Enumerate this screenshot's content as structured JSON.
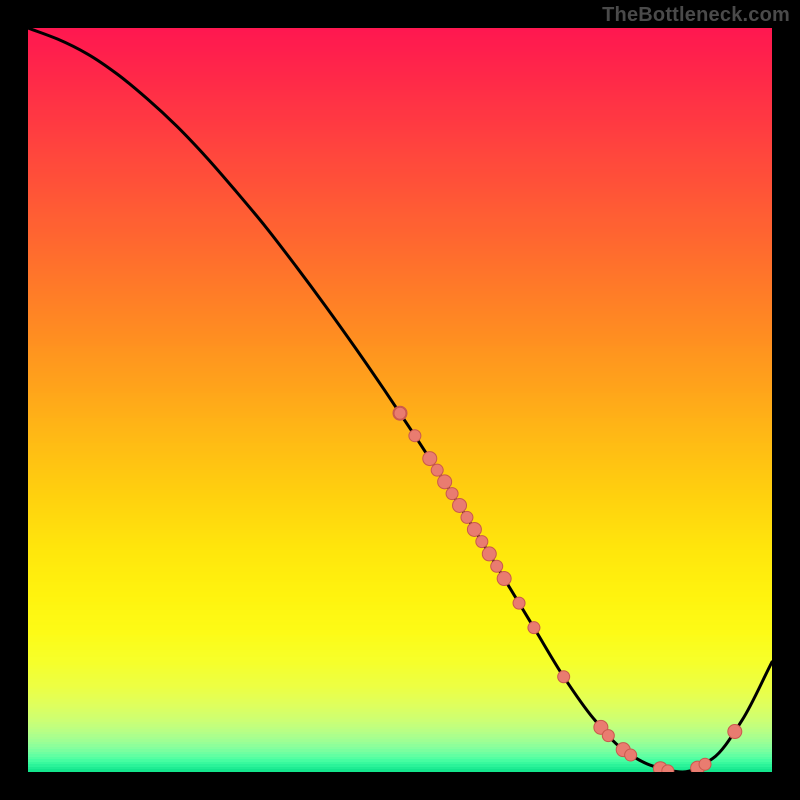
{
  "watermark": "TheBottleneck.com",
  "chart_data": {
    "type": "line",
    "title": "",
    "xlabel": "",
    "ylabel": "",
    "xlim": [
      0,
      100
    ],
    "ylim": [
      0,
      100
    ],
    "grid": false,
    "series": [
      {
        "name": "bottleneck-curve",
        "x": [
          0,
          4,
          8,
          12,
          16,
          20,
          24,
          28,
          32,
          36,
          40,
          44,
          48,
          52,
          56,
          60,
          64,
          68,
          72,
          76,
          80,
          84,
          88,
          92,
          96,
          100
        ],
        "y": [
          100,
          98.5,
          96.5,
          93.8,
          90.5,
          86.8,
          82.6,
          78.0,
          73.2,
          68.0,
          62.6,
          57.0,
          51.2,
          45.2,
          39.0,
          32.6,
          26.0,
          19.4,
          12.8,
          7.2,
          3.0,
          0.8,
          0.0,
          1.8,
          7.0,
          14.8
        ]
      }
    ],
    "scatter_overlay": {
      "name": "highlighted-points",
      "points": [
        {
          "x": 50,
          "y": 48.2,
          "r": 7
        },
        {
          "x": 50,
          "y": 46.2,
          "r": 6
        },
        {
          "x": 52,
          "y": 45.2,
          "r": 6
        },
        {
          "x": 54,
          "y": 42.1,
          "r": 7
        },
        {
          "x": 55,
          "y": 40.5,
          "r": 6
        },
        {
          "x": 56,
          "y": 39.0,
          "r": 7
        },
        {
          "x": 57,
          "y": 37.4,
          "r": 6
        },
        {
          "x": 58,
          "y": 35.8,
          "r": 7
        },
        {
          "x": 59,
          "y": 34.2,
          "r": 6
        },
        {
          "x": 60,
          "y": 32.6,
          "r": 7
        },
        {
          "x": 61,
          "y": 30.9,
          "r": 6
        },
        {
          "x": 62,
          "y": 29.3,
          "r": 7
        },
        {
          "x": 63,
          "y": 27.6,
          "r": 6
        },
        {
          "x": 64,
          "y": 26.0,
          "r": 7
        },
        {
          "x": 66,
          "y": 22.7,
          "r": 6
        },
        {
          "x": 68,
          "y": 19.4,
          "r": 6
        },
        {
          "x": 72,
          "y": 12.8,
          "r": 6
        },
        {
          "x": 77,
          "y": 5.9,
          "r": 7
        },
        {
          "x": 78,
          "y": 4.6,
          "r": 6
        },
        {
          "x": 80,
          "y": 3.0,
          "r": 7
        },
        {
          "x": 81,
          "y": 2.3,
          "r": 6
        },
        {
          "x": 85,
          "y": 0.6,
          "r": 7
        },
        {
          "x": 86,
          "y": 0.4,
          "r": 6
        },
        {
          "x": 90,
          "y": 0.5,
          "r": 7
        },
        {
          "x": 91,
          "y": 1.0,
          "r": 6
        },
        {
          "x": 95,
          "y": 5.5,
          "r": 7
        }
      ]
    },
    "background_gradient_stops": [
      {
        "pos": 0.0,
        "color": "#ff1750"
      },
      {
        "pos": 0.07,
        "color": "#ff2a48"
      },
      {
        "pos": 0.14,
        "color": "#ff3e40"
      },
      {
        "pos": 0.21,
        "color": "#ff5238"
      },
      {
        "pos": 0.28,
        "color": "#ff6630"
      },
      {
        "pos": 0.35,
        "color": "#ff7b28"
      },
      {
        "pos": 0.42,
        "color": "#ff9020"
      },
      {
        "pos": 0.49,
        "color": "#ffa61a"
      },
      {
        "pos": 0.56,
        "color": "#ffbd14"
      },
      {
        "pos": 0.63,
        "color": "#ffd10e"
      },
      {
        "pos": 0.7,
        "color": "#ffe60c"
      },
      {
        "pos": 0.76,
        "color": "#fff30e"
      },
      {
        "pos": 0.81,
        "color": "#fdfb16"
      },
      {
        "pos": 0.85,
        "color": "#f6ff2a"
      },
      {
        "pos": 0.885,
        "color": "#ecff44"
      },
      {
        "pos": 0.91,
        "color": "#deff5e"
      },
      {
        "pos": 0.93,
        "color": "#ccff74"
      },
      {
        "pos": 0.945,
        "color": "#b6ff86"
      },
      {
        "pos": 0.957,
        "color": "#9eff94"
      },
      {
        "pos": 0.967,
        "color": "#84ff9e"
      },
      {
        "pos": 0.975,
        "color": "#68ffa2"
      },
      {
        "pos": 0.982,
        "color": "#4cffa2"
      },
      {
        "pos": 0.988,
        "color": "#32f79c"
      },
      {
        "pos": 0.994,
        "color": "#1ceb92"
      },
      {
        "pos": 1.0,
        "color": "#0adf86"
      }
    ]
  }
}
